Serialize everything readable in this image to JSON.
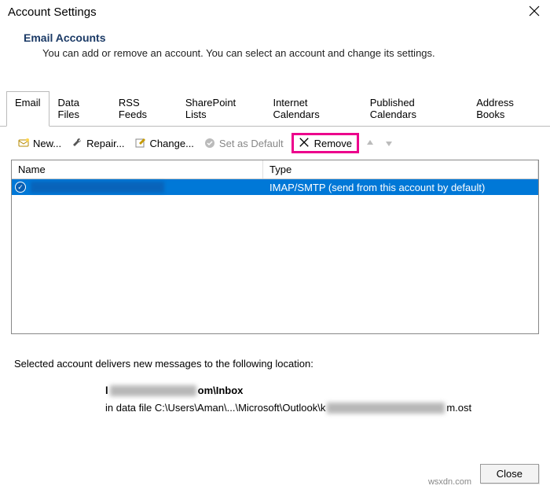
{
  "window": {
    "title": "Account Settings"
  },
  "header": {
    "title": "Email Accounts",
    "description": "You can add or remove an account. You can select an account and change its settings."
  },
  "tabs": [
    {
      "label": "Email",
      "active": true
    },
    {
      "label": "Data Files"
    },
    {
      "label": "RSS Feeds"
    },
    {
      "label": "SharePoint Lists"
    },
    {
      "label": "Internet Calendars"
    },
    {
      "label": "Published Calendars"
    },
    {
      "label": "Address Books"
    }
  ],
  "toolbar": {
    "new": "New...",
    "repair": "Repair...",
    "change": "Change...",
    "setDefault": "Set as Default",
    "remove": "Remove"
  },
  "table": {
    "columns": {
      "name": "Name",
      "type": "Type"
    },
    "rows": [
      {
        "name_redacted": true,
        "type": "IMAP/SMTP (send from this account by default)"
      }
    ]
  },
  "location": {
    "intro": "Selected account delivers new messages to the following location:",
    "line1_prefix": "l",
    "line1_suffix": "om\\Inbox",
    "line2_prefix": "in data file C:\\Users\\Aman\\...\\Microsoft\\Outlook\\k",
    "line2_suffix": "m.ost"
  },
  "footer": {
    "close": "Close"
  },
  "watermark": "wsxdn.com"
}
